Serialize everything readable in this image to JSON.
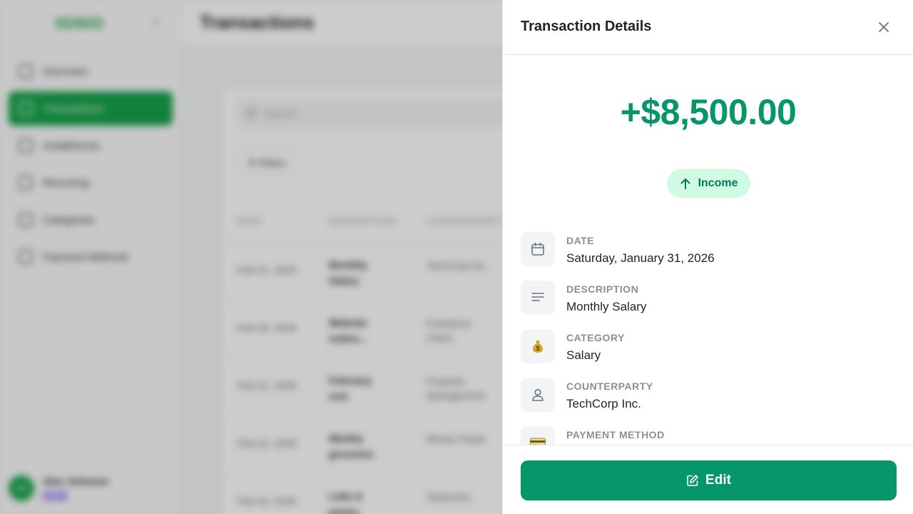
{
  "app": {
    "logo": "IGNIO",
    "page_title": "Transactions",
    "nav": [
      {
        "label": "Overview"
      },
      {
        "label": "Transactions"
      },
      {
        "label": "Installments"
      },
      {
        "label": "Recurring"
      },
      {
        "label": "Categories"
      },
      {
        "label": "Payment Methods"
      }
    ],
    "user": {
      "initials": "AJ",
      "name": "Alex Johnson",
      "plan": "PRO"
    },
    "search_placeholder": "Search...",
    "filters_label": "Filters",
    "table_headers": {
      "date": "DATE",
      "description": "DESCRIPTION",
      "counterparty": "COUNTERPARTY"
    },
    "rows": [
      {
        "date": "Feb 01, 2026",
        "description": "Monthly Salary",
        "counterparty": "TechCorp Inc."
      },
      {
        "date": "Feb 05, 2026",
        "description": "Website redesi...",
        "counterparty": "Freelance Client"
      },
      {
        "date": "Feb 01, 2026",
        "description": "February rent",
        "counterparty": "Property Management"
      },
      {
        "date": "Feb 02, 2026",
        "description": "Weekly groceries",
        "counterparty": "Whole Foods"
      },
      {
        "date": "Feb 03, 2026",
        "description": "Latte & pastry",
        "counterparty": "Starbucks"
      }
    ]
  },
  "drawer": {
    "title": "Transaction Details",
    "amount": "+$8,500.00",
    "type_badge": "Income",
    "details": [
      {
        "icon": "calendar-icon",
        "label": "DATE",
        "value": "Saturday, January 31, 2026"
      },
      {
        "icon": "description-lines-icon",
        "label": "DESCRIPTION",
        "value": "Monthly Salary"
      },
      {
        "icon": "money-bag-icon",
        "label": "CATEGORY",
        "value": "Salary"
      },
      {
        "icon": "user-icon",
        "label": "COUNTERPARTY",
        "value": "TechCorp Inc."
      },
      {
        "icon": "credit-card-icon",
        "label": "PAYMENT METHOD",
        "value": ""
      }
    ],
    "edit_label": "Edit"
  },
  "colors": {
    "accent": "#059669",
    "badge_bg": "#d1fae5",
    "badge_text": "#047857"
  }
}
